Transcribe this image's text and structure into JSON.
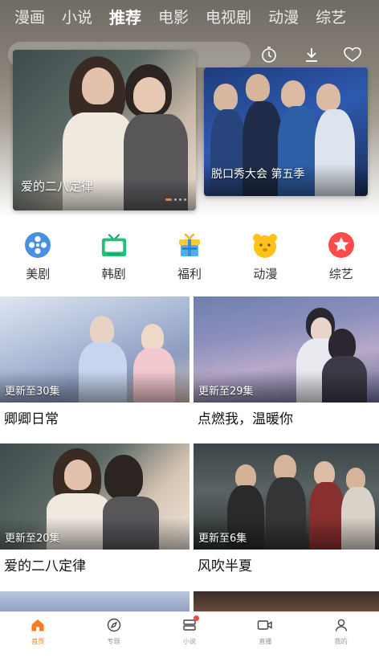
{
  "top_tabs": [
    {
      "label": "漫画"
    },
    {
      "label": "小说"
    },
    {
      "label": "推荐"
    },
    {
      "label": "电影"
    },
    {
      "label": "电视剧"
    },
    {
      "label": "动漫"
    },
    {
      "label": "综艺"
    }
  ],
  "active_tab": "推荐",
  "header_icons": [
    "history-icon",
    "download-icon",
    "favorite-icon"
  ],
  "banners": [
    {
      "title": "爱的二八定律"
    },
    {
      "title": "脱口秀大会 第五季"
    }
  ],
  "categories": [
    {
      "label": "美剧",
      "icon": "film-reel-icon",
      "color": "#4a90e2"
    },
    {
      "label": "韩剧",
      "icon": "tv-icon",
      "color": "#22c07a"
    },
    {
      "label": "福利",
      "icon": "gift-icon",
      "color": "#4fb0f0"
    },
    {
      "label": "动漫",
      "icon": "bear-icon",
      "color": "#ffc21a"
    },
    {
      "label": "综艺",
      "icon": "star-icon",
      "color": "#ff4a4a"
    }
  ],
  "cards": [
    {
      "title": "卿卿日常",
      "update": "更新至30集"
    },
    {
      "title": "点燃我，温暖你",
      "update": "更新至29集"
    },
    {
      "title": "爱的二八定律",
      "update": "更新至20集"
    },
    {
      "title": "风吹半夏",
      "update": "更新至6集"
    }
  ],
  "bottom_nav": [
    {
      "label": "首页",
      "icon": "home-icon"
    },
    {
      "label": "专题",
      "icon": "compass-icon"
    },
    {
      "label": "小说",
      "icon": "book-icon"
    },
    {
      "label": "直播",
      "icon": "video-icon"
    },
    {
      "label": "我的",
      "icon": "person-icon"
    }
  ],
  "accent_color": "#ff7a1a"
}
